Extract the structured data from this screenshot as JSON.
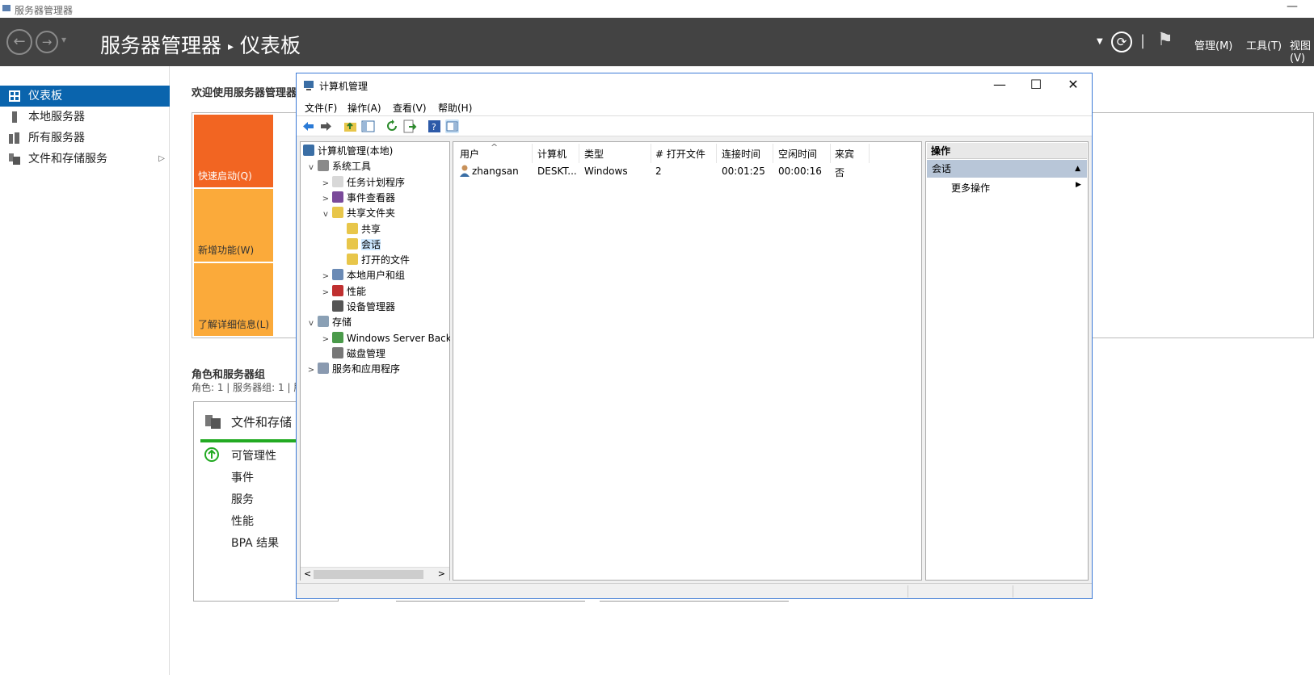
{
  "outer": {
    "title": "服务器管理器",
    "minimize": "—"
  },
  "header": {
    "back": "←",
    "forward": "→",
    "dropdown": "▾",
    "breadcrumb_root": "服务器管理器",
    "separator": "▸",
    "breadcrumb_current": "仪表板",
    "refresh": "⟳",
    "flag": "⚑",
    "menus": [
      "管理(M)",
      "工具(T)",
      "视图(V)"
    ]
  },
  "leftnav": {
    "items": [
      {
        "label": "仪表板",
        "icon": "dashboard-icon",
        "selected": true
      },
      {
        "label": "本地服务器",
        "icon": "server-icon"
      },
      {
        "label": "所有服务器",
        "icon": "servers-icon"
      },
      {
        "label": "文件和存储服务",
        "icon": "storage-icon",
        "arrow": "▷"
      }
    ]
  },
  "dashboard": {
    "welcome": "欢迎使用服务器管理器",
    "tiles": [
      {
        "label": "快速启动(Q)",
        "color": "#f26522"
      },
      {
        "label": "新增功能(W)",
        "color": "#fbaa3a"
      },
      {
        "label": "了解详细信息(L)",
        "color": "#fbaa3a"
      }
    ],
    "roles_title": "角色和服务器组",
    "roles_sub": "角色: 1 | 服务器组: 1 | 服",
    "card_title": "文件和存储",
    "card_items": [
      "可管理性",
      "事件",
      "服务",
      "性能",
      "BPA 结果"
    ],
    "status_color": "#22aa22"
  },
  "window": {
    "title": "计算机管理",
    "controls": {
      "min": "—",
      "max": "☐",
      "close": "✕"
    },
    "menu": [
      "文件(F)",
      "操作(A)",
      "查看(V)",
      "帮助(H)"
    ],
    "tree": [
      {
        "label": "计算机管理(本地)",
        "exp": "",
        "indent": 0,
        "icon": "computer-icon"
      },
      {
        "label": "系统工具",
        "exp": "v",
        "indent": 1,
        "icon": "tools-icon"
      },
      {
        "label": "任务计划程序",
        "exp": ">",
        "indent": 2,
        "icon": "clock-icon"
      },
      {
        "label": "事件查看器",
        "exp": ">",
        "indent": 2,
        "icon": "event-viewer-icon"
      },
      {
        "label": "共享文件夹",
        "exp": "v",
        "indent": 2,
        "icon": "shared-folder-icon"
      },
      {
        "label": "共享",
        "exp": "",
        "indent": 3,
        "icon": "share-icon"
      },
      {
        "label": "会话",
        "exp": "",
        "indent": 3,
        "icon": "session-icon",
        "selected": true
      },
      {
        "label": "打开的文件",
        "exp": "",
        "indent": 3,
        "icon": "open-files-icon"
      },
      {
        "label": "本地用户和组",
        "exp": ">",
        "indent": 2,
        "icon": "users-icon"
      },
      {
        "label": "性能",
        "exp": ">",
        "indent": 2,
        "icon": "performance-icon"
      },
      {
        "label": "设备管理器",
        "exp": "",
        "indent": 2,
        "icon": "device-manager-icon"
      },
      {
        "label": "存储",
        "exp": "v",
        "indent": 1,
        "icon": "storage-icon"
      },
      {
        "label": "Windows Server Back",
        "exp": ">",
        "indent": 2,
        "icon": "backup-icon"
      },
      {
        "label": "磁盘管理",
        "exp": "",
        "indent": 2,
        "icon": "disk-icon"
      },
      {
        "label": "服务和应用程序",
        "exp": ">",
        "indent": 1,
        "icon": "services-icon"
      }
    ],
    "columns": [
      "用户",
      "计算机",
      "类型",
      "# 打开文件",
      "连接时间",
      "空闲时间",
      "来宾"
    ],
    "sort_indicator": "^",
    "rows": [
      {
        "user": "zhangsan",
        "computer": "DESKT...",
        "type": "Windows",
        "open_files": "2",
        "connected": "00:01:25",
        "idle": "00:00:16",
        "guest": "否"
      }
    ],
    "actions": {
      "header": "操作",
      "section": "会话",
      "section_arrow": "▲",
      "more": "更多操作",
      "more_arrow": "▶"
    },
    "scroll": {
      "left": "<",
      "right": ">"
    }
  }
}
